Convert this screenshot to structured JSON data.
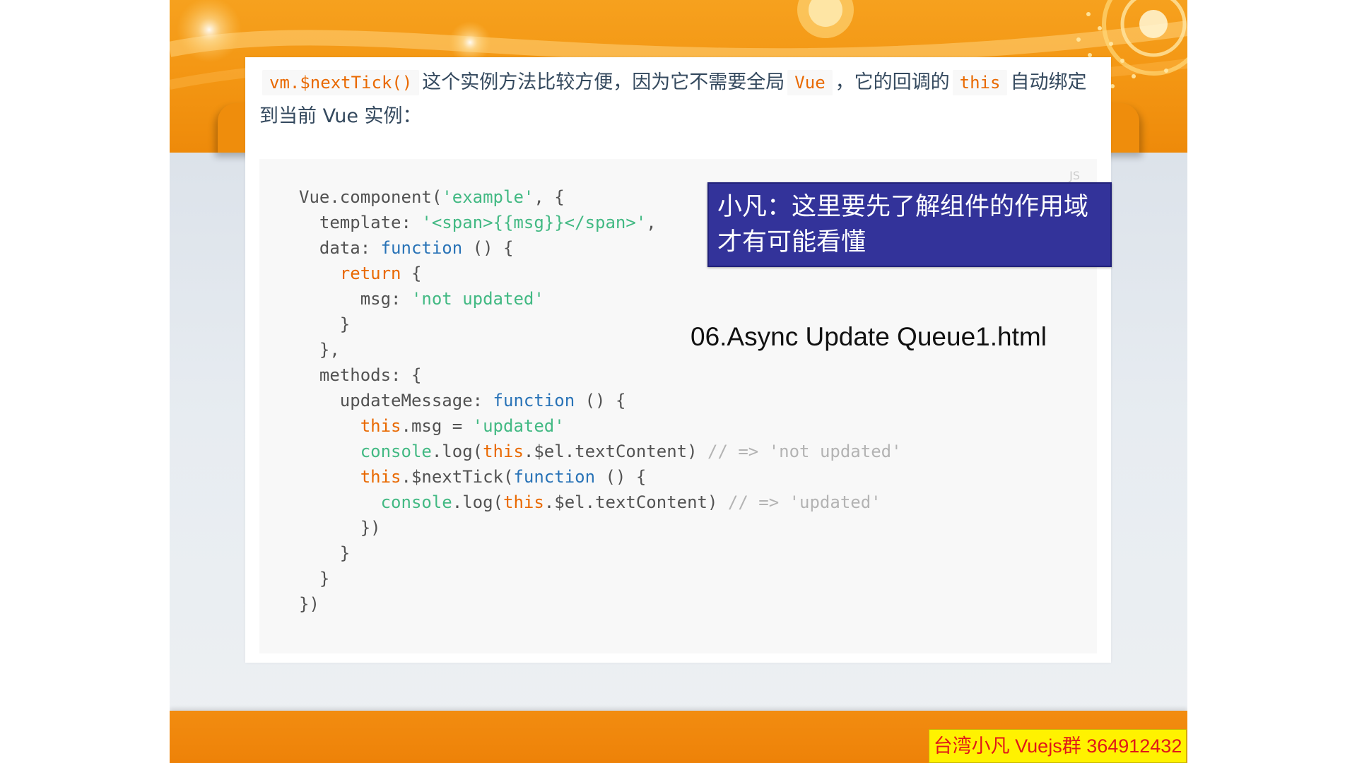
{
  "intro": {
    "method": "vm.$nextTick()",
    "text1": "这个实例方法比较方便，因为它不需要全局",
    "vue": "Vue",
    "text2": "，它的回调的",
    "this_kw": "this",
    "text3": "自动绑定到当前 Vue 实例："
  },
  "code_block": {
    "language": "JS",
    "lines": [
      [
        {
          "t": "Vue.component(",
          "c": "p"
        },
        {
          "t": "'example'",
          "c": "s"
        },
        {
          "t": ", {",
          "c": "p"
        }
      ],
      [
        {
          "t": "  template: ",
          "c": "p"
        },
        {
          "t": "'<span>{{msg}}</span>'",
          "c": "s"
        },
        {
          "t": ",",
          "c": "p"
        }
      ],
      [
        {
          "t": "  data: ",
          "c": "p"
        },
        {
          "t": "function",
          "c": "f"
        },
        {
          "t": " () {",
          "c": "p"
        }
      ],
      [
        {
          "t": "    ",
          "c": "p"
        },
        {
          "t": "return",
          "c": "k"
        },
        {
          "t": " {",
          "c": "p"
        }
      ],
      [
        {
          "t": "      msg: ",
          "c": "p"
        },
        {
          "t": "'not updated'",
          "c": "s"
        }
      ],
      [
        {
          "t": "    }",
          "c": "p"
        }
      ],
      [
        {
          "t": "  },",
          "c": "p"
        }
      ],
      [
        {
          "t": "  methods: {",
          "c": "p"
        }
      ],
      [
        {
          "t": "    updateMessage: ",
          "c": "p"
        },
        {
          "t": "function",
          "c": "f"
        },
        {
          "t": " () {",
          "c": "p"
        }
      ],
      [
        {
          "t": "      ",
          "c": "p"
        },
        {
          "t": "this",
          "c": "k"
        },
        {
          "t": ".msg = ",
          "c": "p"
        },
        {
          "t": "'updated'",
          "c": "s"
        }
      ],
      [
        {
          "t": "      ",
          "c": "p"
        },
        {
          "t": "console",
          "c": "b"
        },
        {
          "t": ".log(",
          "c": "p"
        },
        {
          "t": "this",
          "c": "k"
        },
        {
          "t": ".$el.textContent) ",
          "c": "p"
        },
        {
          "t": "// => 'not updated'",
          "c": "c"
        }
      ],
      [
        {
          "t": "      ",
          "c": "p"
        },
        {
          "t": "this",
          "c": "k"
        },
        {
          "t": ".$nextTick(",
          "c": "p"
        },
        {
          "t": "function",
          "c": "f"
        },
        {
          "t": " () {",
          "c": "p"
        }
      ],
      [
        {
          "t": "        ",
          "c": "p"
        },
        {
          "t": "console",
          "c": "b"
        },
        {
          "t": ".log(",
          "c": "p"
        },
        {
          "t": "this",
          "c": "k"
        },
        {
          "t": ".$el.textContent) ",
          "c": "p"
        },
        {
          "t": "// => 'updated'",
          "c": "c"
        }
      ],
      [
        {
          "t": "      })",
          "c": "p"
        }
      ],
      [
        {
          "t": "    }",
          "c": "p"
        }
      ],
      [
        {
          "t": "  }",
          "c": "p"
        }
      ],
      [
        {
          "t": "})",
          "c": "p"
        }
      ]
    ]
  },
  "note": {
    "line1": "小凡：这里要先了解组件的作用域",
    "line2": "才有可能看懂"
  },
  "file_label": "06.Async Update Queue1.html",
  "badge": "台湾小凡 Vuejs群 364912432",
  "colors": {
    "orange_band": "#f39512",
    "code_bg": "#f8f8f8",
    "string": "#42b983",
    "keyword": "#e96900",
    "function_kw": "#2973b7",
    "comment": "#b3b3b3",
    "note_bg": "#33339a",
    "badge_bg": "#fff200",
    "badge_text": "#e01818"
  }
}
